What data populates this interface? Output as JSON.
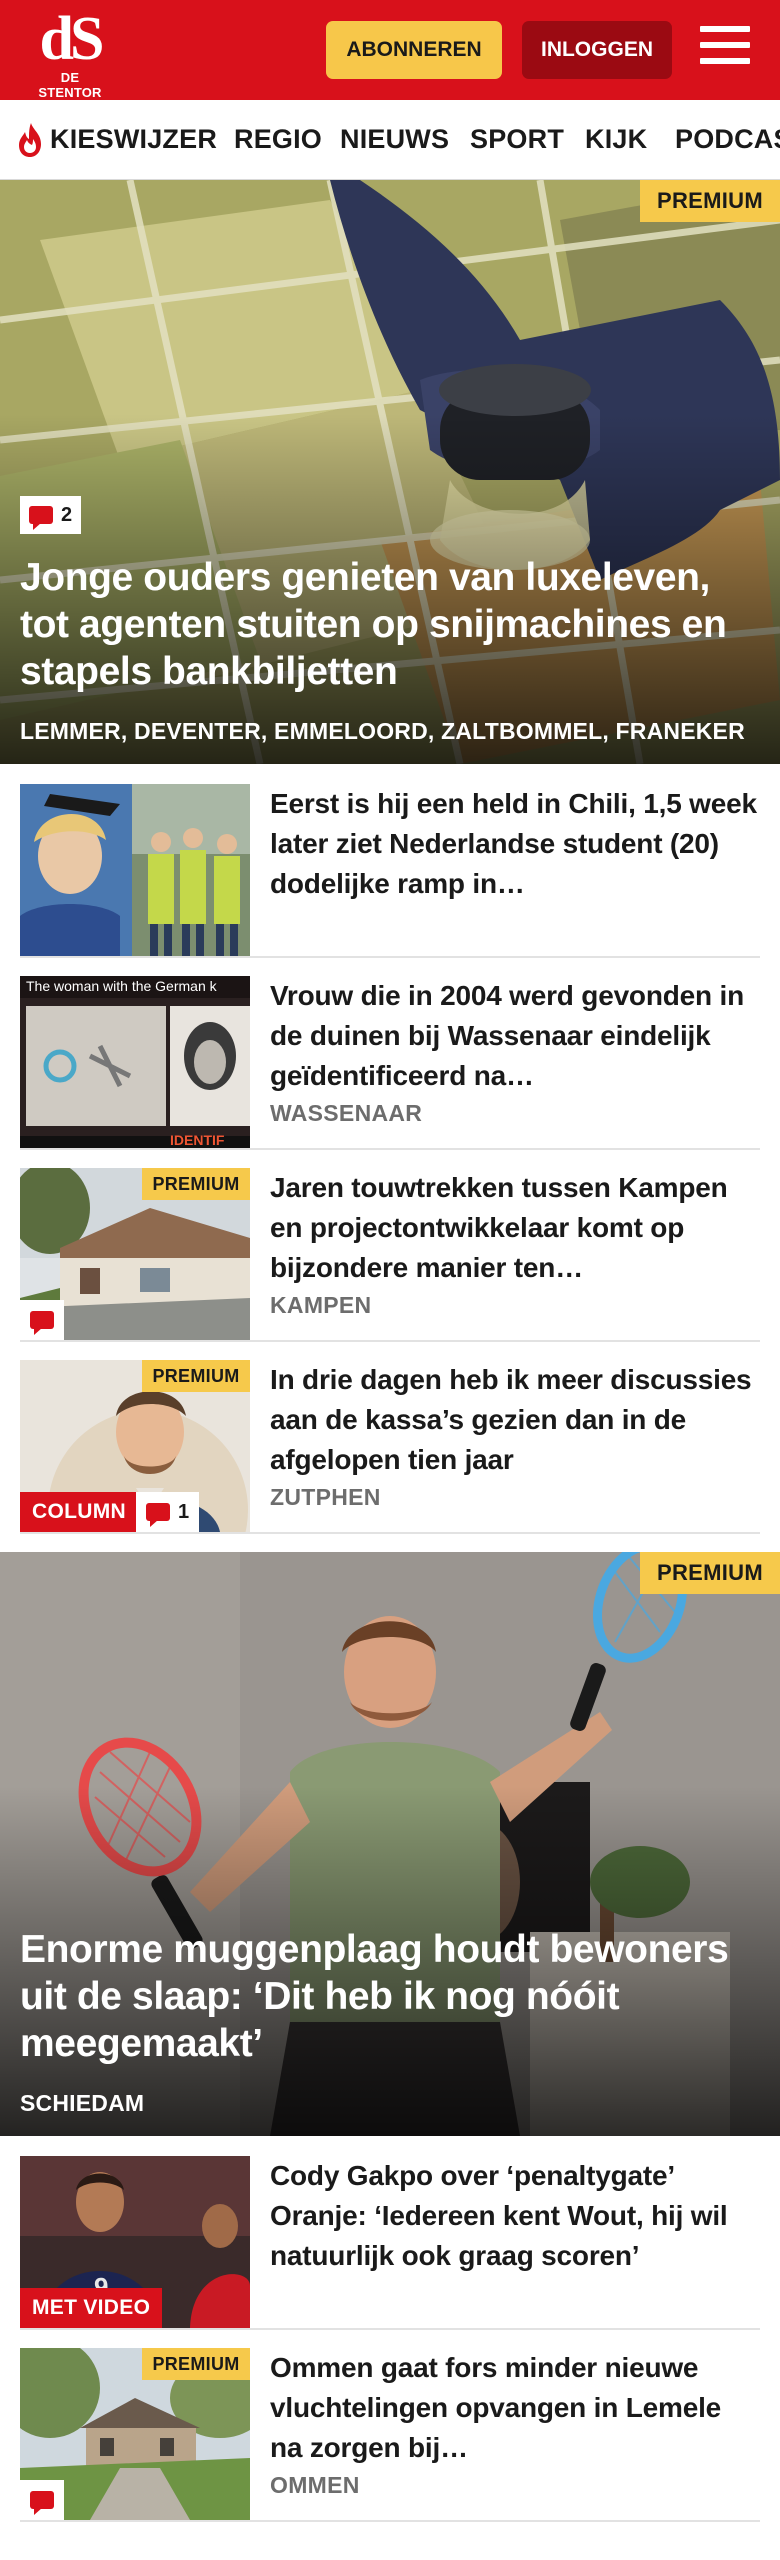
{
  "header": {
    "logo_mark": "dS",
    "logo_text": "DE STENTOR",
    "subscribe_label": "ABONNEREN",
    "login_label": "INLOGGEN"
  },
  "nav": {
    "items": [
      "KIESWIJZER",
      "REGIO",
      "NIEUWS",
      "SPORT",
      "KIJK",
      "PODCAST"
    ]
  },
  "hero1": {
    "premium": "PREMIUM",
    "comments": "2",
    "title": "Jonge ouders genieten van luxeleven, tot agenten stuiten op snijmachines en stapels bankbiljetten",
    "location": "LEMMER, DEVENTER, EMMELOORD, ZALTBOMMEL, FRANEKER"
  },
  "articles": [
    {
      "title": "Eerst is hij een held in Chili, 1,5 week later ziet Nederlandse student (20) dodelijke ramp in…",
      "location": ""
    },
    {
      "title": "Vrouw die in 2004 werd gevonden in de duinen bij Wassenaar eindelijk geïdentificeerd na…",
      "location": "WASSENAAR",
      "thumb_caption": "The woman with the German k",
      "thumb_caption2": "IDENTIF"
    },
    {
      "premium": "PREMIUM",
      "title": "Jaren touwtrekken tussen Kampen en projectontwikkelaar komt op bijzondere manier ten…",
      "location": "KAMPEN"
    },
    {
      "premium": "PREMIUM",
      "tag": "COLUMN",
      "comments": "1",
      "title": "In drie dagen heb ik meer discussies aan de kassa’s gezien dan in de afgelopen tien jaar",
      "location": "ZUTPHEN"
    }
  ],
  "hero2": {
    "premium": "PREMIUM",
    "title": "Enorme muggenplaag houdt bewoners uit de slaap: ‘Dit heb ik nog nóóit meegemaakt’",
    "location": "SCHIEDAM"
  },
  "articles2": [
    {
      "tag": "MET VIDEO",
      "title": "Cody Gakpo over ‘penaltygate’ Oranje: ‘Iedereen kent Wout, hij wil natuurlijk ook graag scoren’",
      "location": ""
    },
    {
      "premium": "PREMIUM",
      "title": "Ommen gaat fors minder nieuwe vluchtelingen opvangen in Lemele na zorgen bij…",
      "location": "OMMEN"
    }
  ],
  "colors": {
    "brand_red": "#d8111b",
    "premium_yellow": "#f6c94b",
    "login_dark_red": "#9b0a12"
  },
  "icons": [
    "flame-icon",
    "menu-icon",
    "comment-icon"
  ]
}
